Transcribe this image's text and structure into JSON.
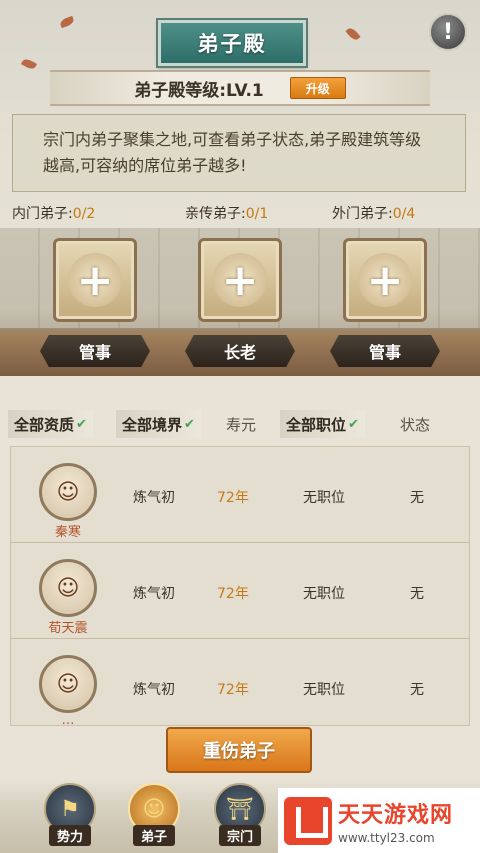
{
  "header": {
    "title": "弟子殿",
    "help_icon": "question-icon"
  },
  "level": {
    "label": "弟子殿等级:LV.1",
    "upgrade_label": "升级"
  },
  "description": "宗门内弟子聚集之地,可查看弟子状态,弟子殿建筑等级越高,可容纳的席位弟子越多!",
  "counts": [
    {
      "label": "内门弟子:",
      "value": "0/2"
    },
    {
      "label": "亲传弟子:",
      "value": "0/1"
    },
    {
      "label": "外门弟子:",
      "value": "0/4"
    }
  ],
  "seats": [
    {
      "icon": "plus-icon",
      "role": "管事"
    },
    {
      "icon": "plus-icon",
      "role": "长老"
    },
    {
      "icon": "plus-icon",
      "role": "管事"
    }
  ],
  "filters": {
    "quality": "全部资质",
    "realm": "全部境界",
    "lifespan": "寿元",
    "position": "全部职位",
    "status": "状态"
  },
  "disciples": [
    {
      "name": "秦寒",
      "realm": "炼气初",
      "age": "72年",
      "position": "无职位",
      "status": "无"
    },
    {
      "name": "荀天震",
      "realm": "炼气初",
      "age": "72年",
      "position": "无职位",
      "status": "无"
    },
    {
      "name": "…",
      "realm": "炼气初",
      "age": "72年",
      "position": "无职位",
      "status": "无"
    }
  ],
  "action_button": "重伤弟子",
  "nav": [
    {
      "label": "势力",
      "icon": "banner-icon"
    },
    {
      "label": "弟子",
      "icon": "disciple-icon"
    },
    {
      "label": "宗门",
      "icon": "gate-icon"
    }
  ],
  "watermark": {
    "title": "天天游戏网",
    "url": "www.ttyl23.com"
  },
  "colors": {
    "teal": "#2e6e69",
    "orange": "#d9761b",
    "gold": "#c47b14",
    "red_name": "#b5532b"
  }
}
